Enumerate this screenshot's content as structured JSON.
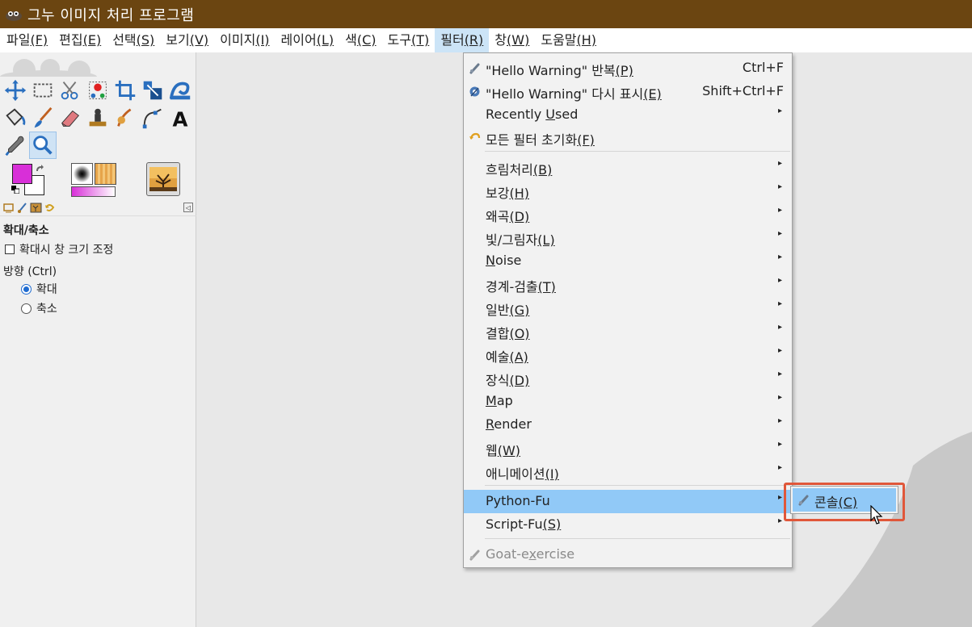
{
  "window": {
    "title": "그누 이미지 처리 프로그램"
  },
  "menubar": [
    {
      "label": "파일",
      "mnemonic": "(F)",
      "active": false
    },
    {
      "label": "편집",
      "mnemonic": "(E)",
      "active": false
    },
    {
      "label": "선택",
      "mnemonic": "(S)",
      "active": false
    },
    {
      "label": "보기",
      "mnemonic": "(V)",
      "active": false
    },
    {
      "label": "이미지",
      "mnemonic": "(I)",
      "active": false
    },
    {
      "label": "레이어",
      "mnemonic": "(L)",
      "active": false
    },
    {
      "label": "색",
      "mnemonic": "(C)",
      "active": false
    },
    {
      "label": "도구",
      "mnemonic": "(T)",
      "active": false
    },
    {
      "label": "필터",
      "mnemonic": "(R)",
      "active": true
    },
    {
      "label": "창",
      "mnemonic": "(W)",
      "active": false
    },
    {
      "label": "도움말",
      "mnemonic": "(H)",
      "active": false
    }
  ],
  "toolbox": {
    "tools": [
      [
        "move-icon",
        "rect-select-icon",
        "scissors-select-icon",
        "foreground-select-icon",
        "crop-icon",
        "scale-icon",
        "warp-icon"
      ],
      [
        "bucket-fill-icon",
        "paintbrush-icon",
        "eraser-icon",
        "clone-icon",
        "smudge-icon",
        "paths-icon",
        "text-icon"
      ],
      [
        "color-picker-icon",
        "zoom-icon"
      ]
    ],
    "selected_tool": "zoom-icon",
    "fg_color": "#d82fd8",
    "bg_color": "#ffffff",
    "options": {
      "title": "확대/축소",
      "resize_window_label": "확대시 창 크기 조정",
      "resize_window_checked": false,
      "direction_label": "방향 (Ctrl)",
      "zoom_in_label": "확대",
      "zoom_out_label": "축소",
      "selected_direction": "확대"
    }
  },
  "filters_menu": {
    "top_items": [
      {
        "label": "\"Hello Warning\" 반복",
        "mnemonic": "(P)",
        "shortcut": "Ctrl+F",
        "icon": "repeat-filter-icon"
      },
      {
        "label": "\"Hello Warning\" 다시 표시",
        "mnemonic": "(E)",
        "shortcut": "Shift+Ctrl+F",
        "icon": "reshow-filter-icon"
      },
      {
        "label_pre": "Recently ",
        "label_mn": "U",
        "label_post": "sed",
        "submenu": true
      },
      {
        "label": "모든 필터 초기화",
        "mnemonic": "(F)",
        "icon": "reset-filters-icon"
      }
    ],
    "category_items": [
      {
        "label": "흐림처리",
        "mnemonic": "(B)"
      },
      {
        "label": "보강",
        "mnemonic": "(H)"
      },
      {
        "label": "왜곡",
        "mnemonic": "(D)"
      },
      {
        "label": "빛/그림자",
        "mnemonic": "(L)"
      },
      {
        "label_mn": "N",
        "label_post": "oise"
      },
      {
        "label": "경계-검출",
        "mnemonic": "(T)"
      },
      {
        "label": "일반",
        "mnemonic": "(G)"
      },
      {
        "label": "결합",
        "mnemonic": "(O)"
      },
      {
        "label": "예술",
        "mnemonic": "(A)"
      },
      {
        "label": "장식",
        "mnemonic": "(D)"
      },
      {
        "label_mn": "M",
        "label_post": "ap"
      },
      {
        "label_mn": "R",
        "label_post": "ender"
      },
      {
        "label": "웹",
        "mnemonic": "(W)"
      },
      {
        "label": "애니메이션",
        "mnemonic": "(I)"
      }
    ],
    "script_items": [
      {
        "label": "Python-Fu",
        "highlighted": true
      },
      {
        "label": "Script-Fu",
        "mnemonic": "(S)"
      }
    ],
    "disabled_item": {
      "label_pre": "Goat-e",
      "label_mn": "x",
      "label_post": "ercise"
    },
    "submenu_arrow": "▸"
  },
  "python_fu_submenu": {
    "label": "콘솔",
    "mnemonic": "(C)"
  }
}
